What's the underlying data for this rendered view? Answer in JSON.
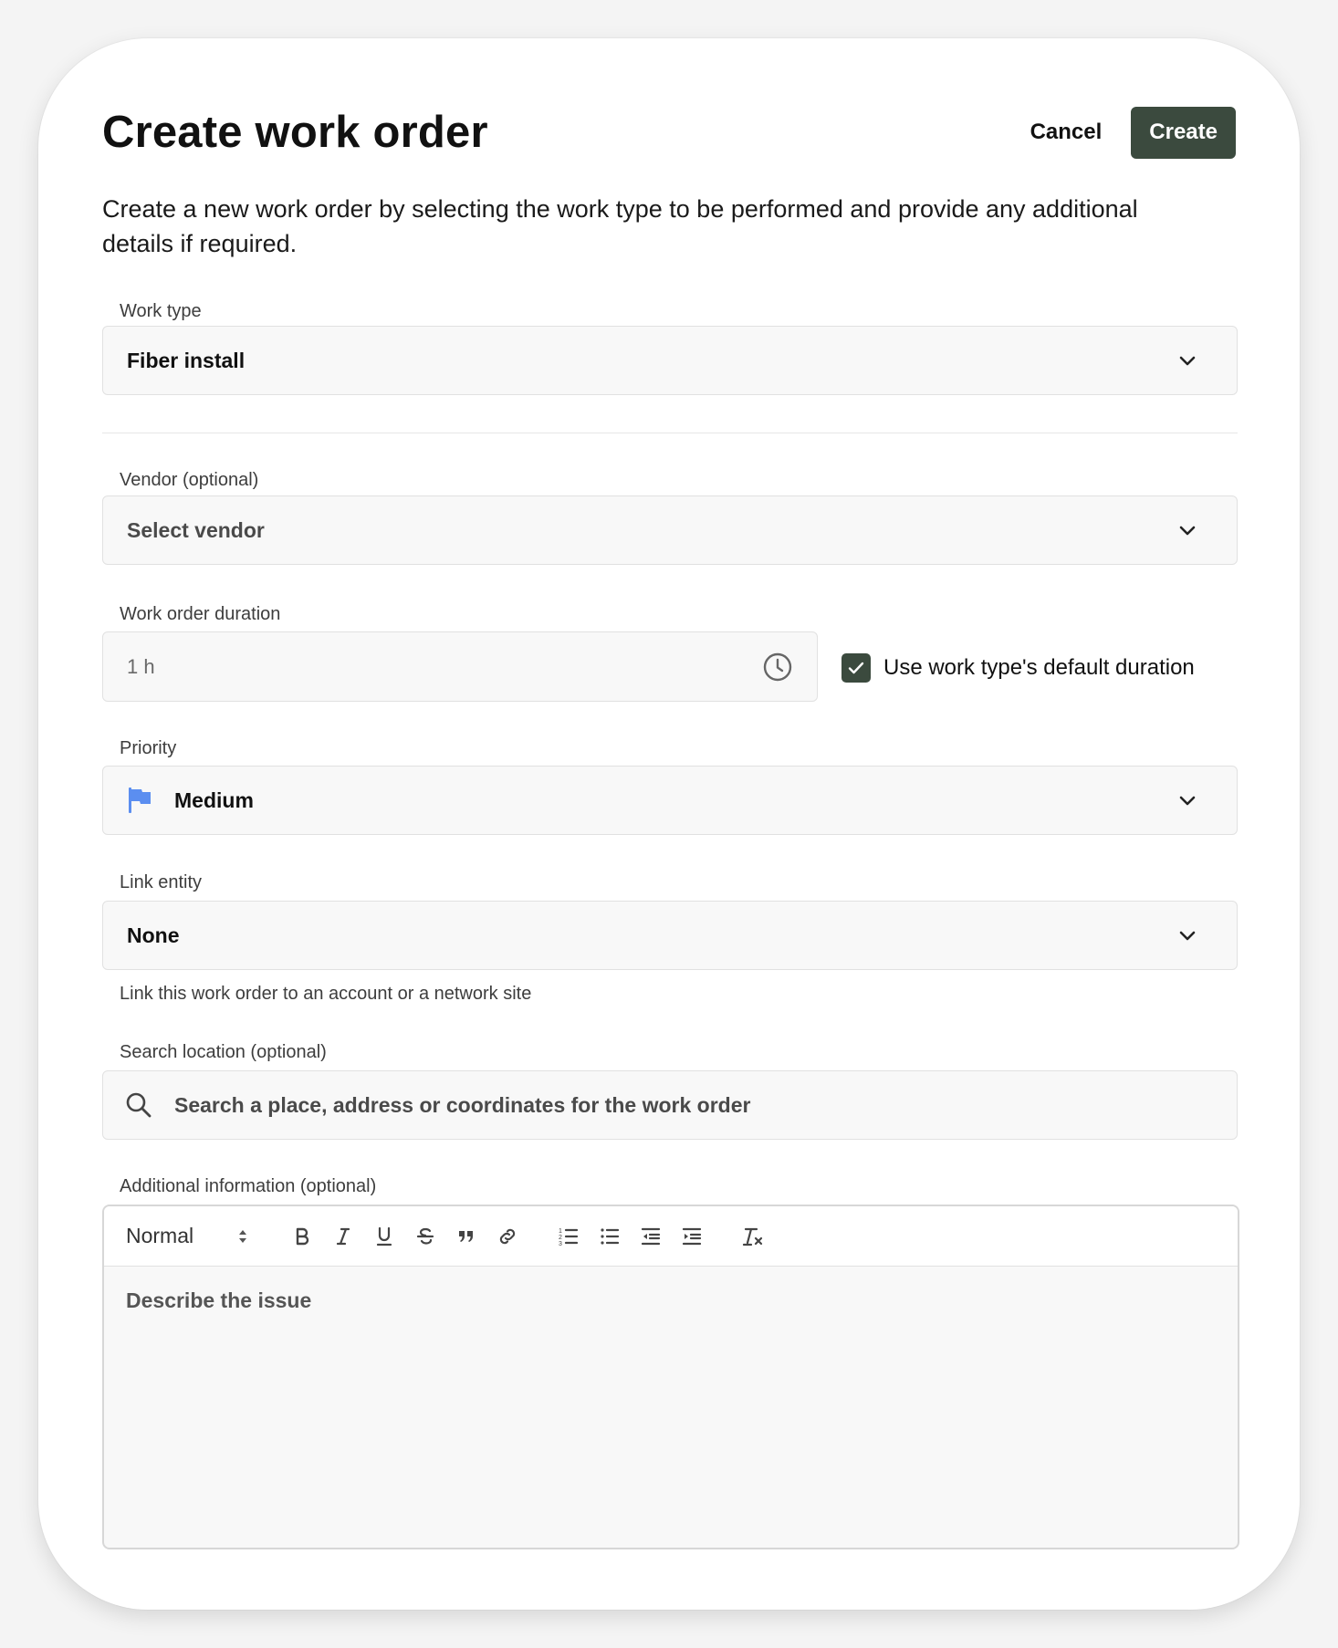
{
  "header": {
    "title": "Create work order",
    "cancel_label": "Cancel",
    "create_label": "Create"
  },
  "description": "Create a new work order by selecting the work type to be performed and provide any additional details if required.",
  "work_type": {
    "label": "Work type",
    "value": "Fiber install"
  },
  "vendor": {
    "label": "Vendor (optional)",
    "value": "Select vendor"
  },
  "duration": {
    "label": "Work order duration",
    "value": "1 h",
    "default_checkbox_label": "Use work type's default duration",
    "default_checked": true
  },
  "priority": {
    "label": "Priority",
    "value": "Medium",
    "flag_color": "#5b8ef0"
  },
  "link_entity": {
    "label": "Link entity",
    "value": "None",
    "hint": "Link this work order to an account or a network site"
  },
  "search_location": {
    "label": "Search location (optional)",
    "placeholder": "Search a place, address or coordinates for the work order"
  },
  "additional_info": {
    "label": "Additional information (optional)",
    "format": "Normal",
    "placeholder": "Describe the issue",
    "toolbar_icons": [
      "bold-icon",
      "italic-icon",
      "underline-icon",
      "strikethrough-icon",
      "quote-icon",
      "link-icon",
      "ordered-list-icon",
      "bullet-list-icon",
      "outdent-icon",
      "indent-icon",
      "clear-format-icon"
    ]
  },
  "colors": {
    "primary": "#3b4a3e",
    "field_bg": "#f8f8f8",
    "border": "#e1e1e1"
  }
}
